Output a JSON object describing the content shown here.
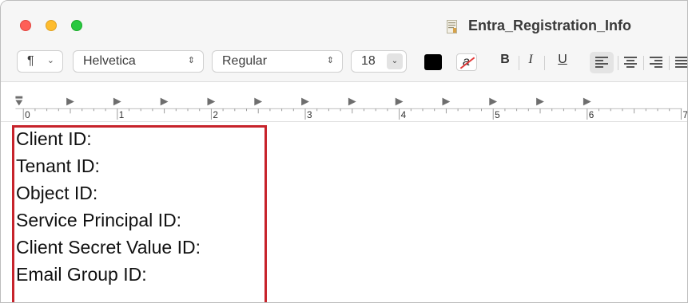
{
  "window": {
    "title": "Entra_Registration_Info"
  },
  "toolbar": {
    "paragraph_label": "¶",
    "font_family": "Helvetica",
    "font_style": "Regular",
    "font_size": "18",
    "text_color": "#000000",
    "bold_label": "B",
    "italic_label": "I",
    "underline_label": "U"
  },
  "ruler": {
    "numbers": [
      "0",
      "1",
      "2",
      "3",
      "4",
      "5",
      "6",
      "7"
    ]
  },
  "document": {
    "lines": [
      "Client ID:",
      "Tenant ID:",
      "Object ID:",
      "Service Principal ID:",
      "Client Secret Value ID:",
      "Email Group ID:"
    ]
  },
  "colors": {
    "highlight_border": "#c7232b",
    "close": "#fe5f57",
    "minimize": "#febc2e",
    "zoom": "#28c840"
  }
}
